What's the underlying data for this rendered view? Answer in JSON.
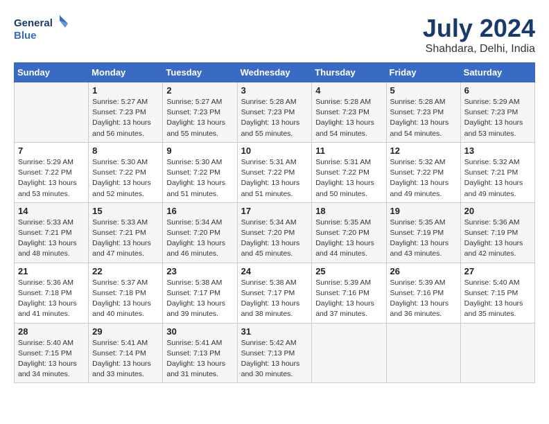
{
  "header": {
    "logo_line1": "General",
    "logo_line2": "Blue",
    "month_year": "July 2024",
    "location": "Shahdara, Delhi, India"
  },
  "days_of_week": [
    "Sunday",
    "Monday",
    "Tuesday",
    "Wednesday",
    "Thursday",
    "Friday",
    "Saturday"
  ],
  "weeks": [
    [
      {
        "day": "",
        "info": ""
      },
      {
        "day": "1",
        "info": "Sunrise: 5:27 AM\nSunset: 7:23 PM\nDaylight: 13 hours\nand 56 minutes."
      },
      {
        "day": "2",
        "info": "Sunrise: 5:27 AM\nSunset: 7:23 PM\nDaylight: 13 hours\nand 55 minutes."
      },
      {
        "day": "3",
        "info": "Sunrise: 5:28 AM\nSunset: 7:23 PM\nDaylight: 13 hours\nand 55 minutes."
      },
      {
        "day": "4",
        "info": "Sunrise: 5:28 AM\nSunset: 7:23 PM\nDaylight: 13 hours\nand 54 minutes."
      },
      {
        "day": "5",
        "info": "Sunrise: 5:28 AM\nSunset: 7:23 PM\nDaylight: 13 hours\nand 54 minutes."
      },
      {
        "day": "6",
        "info": "Sunrise: 5:29 AM\nSunset: 7:23 PM\nDaylight: 13 hours\nand 53 minutes."
      }
    ],
    [
      {
        "day": "7",
        "info": "Sunrise: 5:29 AM\nSunset: 7:22 PM\nDaylight: 13 hours\nand 53 minutes."
      },
      {
        "day": "8",
        "info": "Sunrise: 5:30 AM\nSunset: 7:22 PM\nDaylight: 13 hours\nand 52 minutes."
      },
      {
        "day": "9",
        "info": "Sunrise: 5:30 AM\nSunset: 7:22 PM\nDaylight: 13 hours\nand 51 minutes."
      },
      {
        "day": "10",
        "info": "Sunrise: 5:31 AM\nSunset: 7:22 PM\nDaylight: 13 hours\nand 51 minutes."
      },
      {
        "day": "11",
        "info": "Sunrise: 5:31 AM\nSunset: 7:22 PM\nDaylight: 13 hours\nand 50 minutes."
      },
      {
        "day": "12",
        "info": "Sunrise: 5:32 AM\nSunset: 7:22 PM\nDaylight: 13 hours\nand 49 minutes."
      },
      {
        "day": "13",
        "info": "Sunrise: 5:32 AM\nSunset: 7:21 PM\nDaylight: 13 hours\nand 49 minutes."
      }
    ],
    [
      {
        "day": "14",
        "info": "Sunrise: 5:33 AM\nSunset: 7:21 PM\nDaylight: 13 hours\nand 48 minutes."
      },
      {
        "day": "15",
        "info": "Sunrise: 5:33 AM\nSunset: 7:21 PM\nDaylight: 13 hours\nand 47 minutes."
      },
      {
        "day": "16",
        "info": "Sunrise: 5:34 AM\nSunset: 7:20 PM\nDaylight: 13 hours\nand 46 minutes."
      },
      {
        "day": "17",
        "info": "Sunrise: 5:34 AM\nSunset: 7:20 PM\nDaylight: 13 hours\nand 45 minutes."
      },
      {
        "day": "18",
        "info": "Sunrise: 5:35 AM\nSunset: 7:20 PM\nDaylight: 13 hours\nand 44 minutes."
      },
      {
        "day": "19",
        "info": "Sunrise: 5:35 AM\nSunset: 7:19 PM\nDaylight: 13 hours\nand 43 minutes."
      },
      {
        "day": "20",
        "info": "Sunrise: 5:36 AM\nSunset: 7:19 PM\nDaylight: 13 hours\nand 42 minutes."
      }
    ],
    [
      {
        "day": "21",
        "info": "Sunrise: 5:36 AM\nSunset: 7:18 PM\nDaylight: 13 hours\nand 41 minutes."
      },
      {
        "day": "22",
        "info": "Sunrise: 5:37 AM\nSunset: 7:18 PM\nDaylight: 13 hours\nand 40 minutes."
      },
      {
        "day": "23",
        "info": "Sunrise: 5:38 AM\nSunset: 7:17 PM\nDaylight: 13 hours\nand 39 minutes."
      },
      {
        "day": "24",
        "info": "Sunrise: 5:38 AM\nSunset: 7:17 PM\nDaylight: 13 hours\nand 38 minutes."
      },
      {
        "day": "25",
        "info": "Sunrise: 5:39 AM\nSunset: 7:16 PM\nDaylight: 13 hours\nand 37 minutes."
      },
      {
        "day": "26",
        "info": "Sunrise: 5:39 AM\nSunset: 7:16 PM\nDaylight: 13 hours\nand 36 minutes."
      },
      {
        "day": "27",
        "info": "Sunrise: 5:40 AM\nSunset: 7:15 PM\nDaylight: 13 hours\nand 35 minutes."
      }
    ],
    [
      {
        "day": "28",
        "info": "Sunrise: 5:40 AM\nSunset: 7:15 PM\nDaylight: 13 hours\nand 34 minutes."
      },
      {
        "day": "29",
        "info": "Sunrise: 5:41 AM\nSunset: 7:14 PM\nDaylight: 13 hours\nand 33 minutes."
      },
      {
        "day": "30",
        "info": "Sunrise: 5:41 AM\nSunset: 7:13 PM\nDaylight: 13 hours\nand 31 minutes."
      },
      {
        "day": "31",
        "info": "Sunrise: 5:42 AM\nSunset: 7:13 PM\nDaylight: 13 hours\nand 30 minutes."
      },
      {
        "day": "",
        "info": ""
      },
      {
        "day": "",
        "info": ""
      },
      {
        "day": "",
        "info": ""
      }
    ]
  ]
}
